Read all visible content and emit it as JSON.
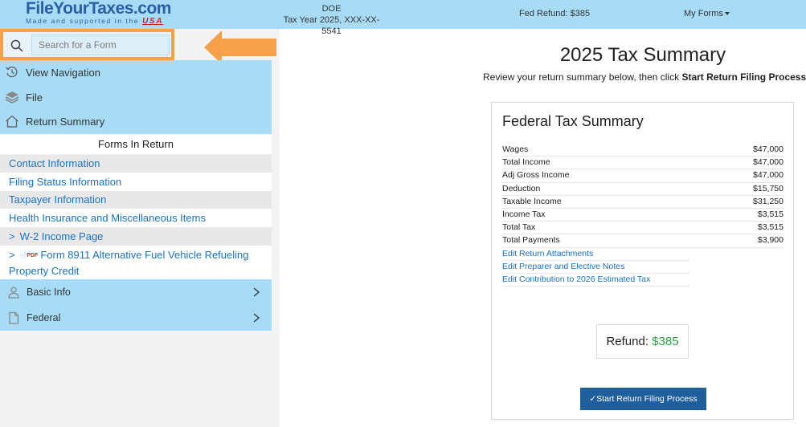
{
  "header": {
    "logo_main": "FileYourTaxes.com",
    "logo_sub": "Made and supported in the",
    "logo_usa": "USA",
    "taxpayer_name": "DOE",
    "taxpayer_info": "Tax Year 2025, XXX-XX-5541",
    "fed_refund": "Fed Refund: $385",
    "my_forms": "My Forms"
  },
  "sidebar": {
    "search_placeholder": "Search for a Form",
    "menu": [
      {
        "label": "View Navigation",
        "icon": "history-icon"
      },
      {
        "label": "File",
        "icon": "layers-icon"
      },
      {
        "label": "Return Summary",
        "icon": "home-icon"
      }
    ],
    "forms_header": "Forms In Return",
    "forms": [
      {
        "label": "Contact Information"
      },
      {
        "label": "Filing Status Information"
      },
      {
        "label": "Taxpayer Information"
      },
      {
        "label": "Health Insurance and Miscellaneous Items"
      },
      {
        "label": "W-2 Income Page"
      },
      {
        "label": "Form 8911 Alternative Fuel Vehicle Refueling Property Credit",
        "badge": "PDF"
      }
    ],
    "groups": [
      {
        "label": "Basic Info",
        "icon": "person-icon"
      },
      {
        "label": "Federal",
        "icon": "document-icon"
      }
    ]
  },
  "main": {
    "title": "2025 Tax Summary",
    "subtitle_prefix": "Review your return summary below, then click ",
    "subtitle_bold": "Start Return Filing Process",
    "card_title": "Federal Tax Summary",
    "summary": [
      {
        "label": "Wages",
        "value": "$47,000"
      },
      {
        "label": "Total Income",
        "value": "$47,000"
      },
      {
        "label": "Adj Gross Income",
        "value": "$47,000"
      },
      {
        "label": "Deduction",
        "value": "$15,750"
      },
      {
        "label": "Taxable Income",
        "value": "$31,250"
      },
      {
        "label": "Income Tax",
        "value": "$3,515"
      },
      {
        "label": "Total Tax",
        "value": "$3,515"
      },
      {
        "label": "Total Payments",
        "value": "$3,900"
      }
    ],
    "links": [
      {
        "label": "Edit Return Attachments"
      },
      {
        "label": "Edit Preparer and Elective Notes"
      },
      {
        "label": "Edit Contribution to 2026 Estimated Tax"
      }
    ],
    "refund_label": "Refund: ",
    "refund_amount": "$385",
    "file_button": "✓Start Return Filing Process"
  },
  "colors": {
    "topbar": "#a8dcf6",
    "highlight": "#f7a04a",
    "link": "#1a73c8",
    "button": "#1f5f9e",
    "refund": "#2ea043"
  }
}
